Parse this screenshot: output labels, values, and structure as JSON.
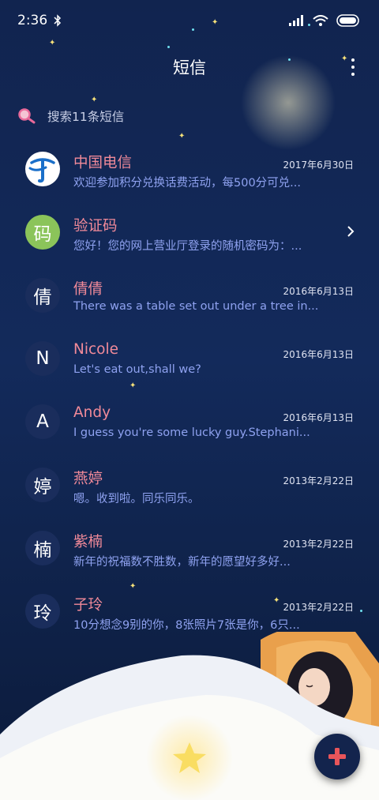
{
  "status_bar": {
    "time": "2:36",
    "bluetooth_icon": "bluetooth-icon",
    "signal_icon": "signal-icon",
    "wifi_icon": "wifi-icon",
    "battery_icon": "battery-icon"
  },
  "header": {
    "title": "短信",
    "more_icon": "more-vert-icon"
  },
  "search": {
    "placeholder": "搜索11条短信",
    "icon": "search-icon"
  },
  "conversations": [
    {
      "avatar": "",
      "avatar_type": "telecom-logo",
      "name": "中国电信",
      "preview": "欢迎参加积分兑换话费活动，每500分可兑...",
      "date": "2017年6月30日"
    },
    {
      "avatar": "码",
      "avatar_type": "green",
      "name": "验证码",
      "preview": "您好！您的网上营业厅登录的随机密码为：...",
      "date": ""
    },
    {
      "avatar": "倩",
      "avatar_type": "dark",
      "name": "倩倩",
      "preview": "There was a table set out under a tree in...",
      "date": "2016年6月13日"
    },
    {
      "avatar": "N",
      "avatar_type": "dark",
      "name": "Nicole",
      "preview": "Let's eat out,shall we?",
      "date": "2016年6月13日"
    },
    {
      "avatar": "A",
      "avatar_type": "dark",
      "name": "Andy",
      "preview": "I guess you're some lucky guy.Stephani...",
      "date": "2016年6月13日"
    },
    {
      "avatar": "婷",
      "avatar_type": "dark",
      "name": "燕婷",
      "preview": "嗯。收到啦。同乐同乐。",
      "date": "2013年2月22日"
    },
    {
      "avatar": "楠",
      "avatar_type": "dark",
      "name": "紫楠",
      "preview": "新年的祝福数不胜数，新年的愿望好多好...",
      "date": "2013年2月22日"
    },
    {
      "avatar": "玲",
      "avatar_type": "dark",
      "name": "子玲",
      "preview": "10分想念9别的你，8张照片7张是你，6只...",
      "date": "2013年2月22日"
    }
  ],
  "fab": {
    "icon": "plus-icon",
    "color": "#e8555a"
  },
  "colors": {
    "name": "#f18a99",
    "preview": "#8fa2f0",
    "background": "#132a5b"
  }
}
